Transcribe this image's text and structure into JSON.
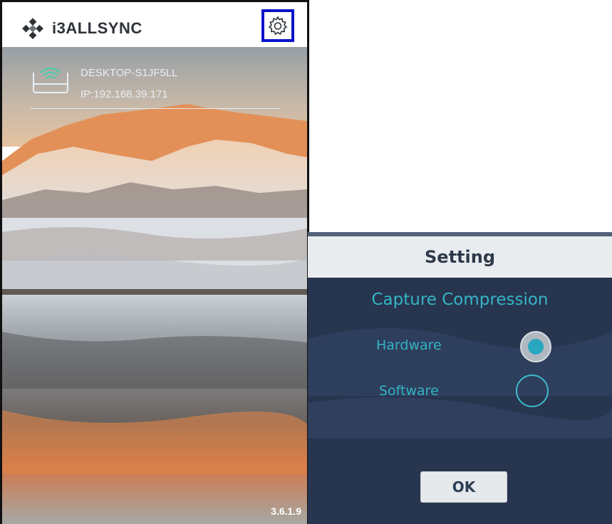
{
  "app": {
    "logo_text": "i3ALLSYNC"
  },
  "device": {
    "name": "DESKTOP-S1JF5LL",
    "ip": "IP:192.168.39.171"
  },
  "version": "3.6.1.9",
  "settings_dialog": {
    "title": "Setting",
    "section_title": "Capture Compression",
    "options": [
      {
        "label": "Hardware",
        "selected": true
      },
      {
        "label": "Software",
        "selected": false
      }
    ],
    "ok_label": "OK"
  },
  "colors": {
    "accent": "#33b5c3",
    "settings_highlight": "#0a14c8",
    "dialog_background": "#27354f"
  },
  "icons": {
    "logo": "diamond-logo-icon",
    "settings": "gear-icon",
    "device": "router-wifi-icon"
  }
}
